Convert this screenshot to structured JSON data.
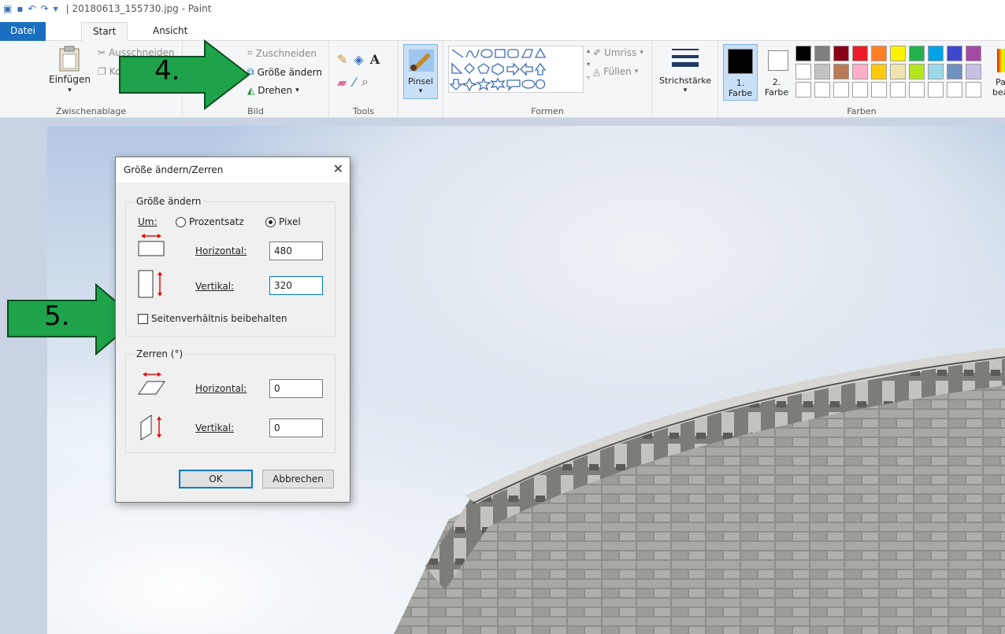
{
  "titlebar": {
    "file_title": "| 20180613_155730.jpg - Paint"
  },
  "tabs": {
    "datei": "Datei",
    "start": "Start",
    "ansicht": "Ansicht"
  },
  "ribbon": {
    "clipboard": {
      "paste": "Einfügen",
      "cut": "Ausschneiden",
      "copy": "Ko",
      "group": "Zwischenablage"
    },
    "image": {
      "crop": "Zuschneiden",
      "resize": "Größe ändern",
      "rotate": "Drehen",
      "select": "n",
      "group": "Bild"
    },
    "tools": {
      "group": "Tools"
    },
    "brush": {
      "label": "Pinsel"
    },
    "shapes": {
      "outline": "Umriss",
      "fill": "Füllen",
      "group": "Formen"
    },
    "stroke": {
      "label": "Strichstärke"
    },
    "colors": {
      "color1_num": "1.",
      "color1": "Farbe",
      "color2_num": "2.",
      "color2": "Farbe",
      "group": "Farben",
      "edit_top": "Pa",
      "edit_bottom": "bear",
      "palette_row1": [
        "#000000",
        "#7f7f7f",
        "#880015",
        "#ed1c24",
        "#ff7f27",
        "#fff200",
        "#22b14c",
        "#00a2e8",
        "#3f48cc",
        "#a349a4"
      ],
      "palette_row2": [
        "#ffffff",
        "#c3c3c3",
        "#b97a57",
        "#ffaec9",
        "#ffc90e",
        "#efe4b0",
        "#b5e61d",
        "#99d9ea",
        "#7092be",
        "#c8bfe7"
      ]
    }
  },
  "annotations": {
    "step4": "4.",
    "step5": "5."
  },
  "dialog": {
    "title": "Größe ändern/Zerren",
    "resize_legend": "Größe ändern",
    "by_label": "Um:",
    "percent": "Prozentsatz",
    "pixel": "Pixel",
    "h_label": "Horizontal:",
    "h_value": "480",
    "v_label": "Vertikal:",
    "v_value": "320",
    "keep_ratio": "Seitenverhältnis beibehalten",
    "skew_legend": "Zerren (°)",
    "skew_h_label": "Horizontal:",
    "skew_h_value": "0",
    "skew_v_label": "Vertikal:",
    "skew_v_value": "0",
    "ok": "OK",
    "cancel": "Abbrechen"
  }
}
